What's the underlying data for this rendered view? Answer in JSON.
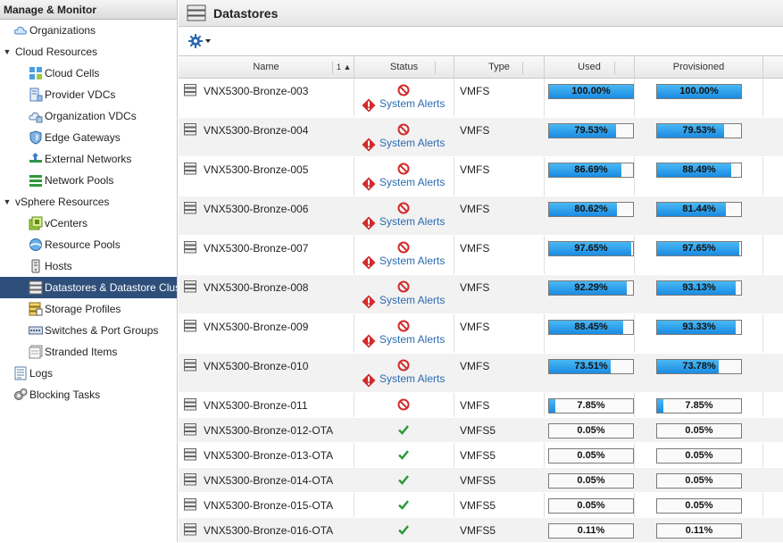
{
  "sidebar": {
    "title": "Manage & Monitor",
    "items": [
      {
        "label": "Organizations",
        "level": 0,
        "icon": "cloud-icon"
      },
      {
        "label": "Cloud Resources",
        "level": 0,
        "section": true
      },
      {
        "label": "Cloud Cells",
        "level": 1,
        "icon": "cloud-cells-icon"
      },
      {
        "label": "Provider VDCs",
        "level": 1,
        "icon": "provider-vdc-icon"
      },
      {
        "label": "Organization VDCs",
        "level": 1,
        "icon": "org-vdc-icon"
      },
      {
        "label": "Edge Gateways",
        "level": 1,
        "icon": "edge-gateway-icon"
      },
      {
        "label": "External Networks",
        "level": 1,
        "icon": "external-network-icon"
      },
      {
        "label": "Network Pools",
        "level": 1,
        "icon": "network-pool-icon"
      },
      {
        "label": "vSphere Resources",
        "level": 0,
        "section": true
      },
      {
        "label": "vCenters",
        "level": 1,
        "icon": "vcenter-icon"
      },
      {
        "label": "Resource Pools",
        "level": 1,
        "icon": "resource-pool-icon"
      },
      {
        "label": "Hosts",
        "level": 1,
        "icon": "host-icon"
      },
      {
        "label": "Datastores & Datastore Clusters",
        "level": 1,
        "icon": "datastore-icon",
        "selected": true
      },
      {
        "label": "Storage Profiles",
        "level": 1,
        "icon": "storage-profile-icon"
      },
      {
        "label": "Switches & Port Groups",
        "level": 1,
        "icon": "switch-icon"
      },
      {
        "label": "Stranded Items",
        "level": 1,
        "icon": "stranded-items-icon"
      },
      {
        "label": "Logs",
        "level": 0,
        "icon": "logs-icon"
      },
      {
        "label": "Blocking Tasks",
        "level": 0,
        "icon": "blocking-tasks-icon"
      }
    ]
  },
  "main": {
    "title": "Datastores",
    "sort_indicator": "1 ▲",
    "columns": {
      "name": "Name",
      "status": "Status",
      "type": "Type",
      "used": "Used",
      "provisioned": "Provisioned"
    },
    "alert_text": "System Alerts",
    "colors": {
      "bar_fill": "#1a8be2",
      "error": "#d22b2b",
      "ok": "#2e9a3a",
      "link": "#2a6bb1",
      "selected": "#2e4f7a"
    },
    "rows": [
      {
        "name": "VNX5300-Bronze-003",
        "status": "error",
        "alerts": true,
        "type": "VMFS",
        "used": 100.0,
        "used_label": "100.00%",
        "provisioned": 100.0,
        "provisioned_label": "100.00%"
      },
      {
        "name": "VNX5300-Bronze-004",
        "status": "error",
        "alerts": true,
        "type": "VMFS",
        "used": 79.53,
        "used_label": "79.53%",
        "provisioned": 79.53,
        "provisioned_label": "79.53%"
      },
      {
        "name": "VNX5300-Bronze-005",
        "status": "error",
        "alerts": true,
        "type": "VMFS",
        "used": 86.69,
        "used_label": "86.69%",
        "provisioned": 88.49,
        "provisioned_label": "88.49%"
      },
      {
        "name": "VNX5300-Bronze-006",
        "status": "error",
        "alerts": true,
        "type": "VMFS",
        "used": 80.62,
        "used_label": "80.62%",
        "provisioned": 81.44,
        "provisioned_label": "81.44%"
      },
      {
        "name": "VNX5300-Bronze-007",
        "status": "error",
        "alerts": true,
        "type": "VMFS",
        "used": 97.65,
        "used_label": "97.65%",
        "provisioned": 97.65,
        "provisioned_label": "97.65%"
      },
      {
        "name": "VNX5300-Bronze-008",
        "status": "error",
        "alerts": true,
        "type": "VMFS",
        "used": 92.29,
        "used_label": "92.29%",
        "provisioned": 93.13,
        "provisioned_label": "93.13%"
      },
      {
        "name": "VNX5300-Bronze-009",
        "status": "error",
        "alerts": true,
        "type": "VMFS",
        "used": 88.45,
        "used_label": "88.45%",
        "provisioned": 93.33,
        "provisioned_label": "93.33%"
      },
      {
        "name": "VNX5300-Bronze-010",
        "status": "error",
        "alerts": true,
        "type": "VMFS",
        "used": 73.51,
        "used_label": "73.51%",
        "provisioned": 73.78,
        "provisioned_label": "73.78%"
      },
      {
        "name": "VNX5300-Bronze-011",
        "status": "error",
        "alerts": false,
        "type": "VMFS",
        "used": 7.85,
        "used_label": "7.85%",
        "provisioned": 7.85,
        "provisioned_label": "7.85%"
      },
      {
        "name": "VNX5300-Bronze-012-OTA",
        "status": "ok",
        "alerts": false,
        "type": "VMFS5",
        "used": 0.05,
        "used_label": "0.05%",
        "provisioned": 0.05,
        "provisioned_label": "0.05%"
      },
      {
        "name": "VNX5300-Bronze-013-OTA",
        "status": "ok",
        "alerts": false,
        "type": "VMFS5",
        "used": 0.05,
        "used_label": "0.05%",
        "provisioned": 0.05,
        "provisioned_label": "0.05%"
      },
      {
        "name": "VNX5300-Bronze-014-OTA",
        "status": "ok",
        "alerts": false,
        "type": "VMFS5",
        "used": 0.05,
        "used_label": "0.05%",
        "provisioned": 0.05,
        "provisioned_label": "0.05%"
      },
      {
        "name": "VNX5300-Bronze-015-OTA",
        "status": "ok",
        "alerts": false,
        "type": "VMFS5",
        "used": 0.05,
        "used_label": "0.05%",
        "provisioned": 0.05,
        "provisioned_label": "0.05%"
      },
      {
        "name": "VNX5300-Bronze-016-OTA",
        "status": "ok",
        "alerts": false,
        "type": "VMFS5",
        "used": 0.11,
        "used_label": "0.11%",
        "provisioned": 0.11,
        "provisioned_label": "0.11%"
      }
    ]
  }
}
